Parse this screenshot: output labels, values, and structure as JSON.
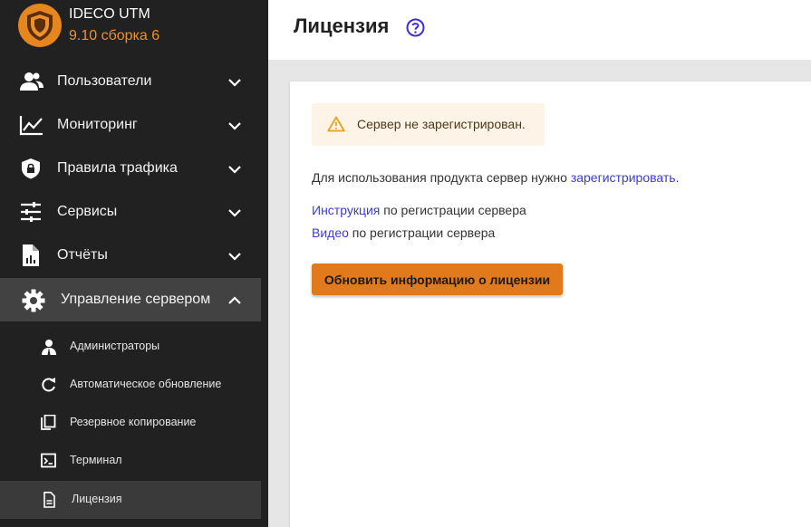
{
  "brand": {
    "name": "IDECO UTM",
    "version": "9.10 сборка 6"
  },
  "sidebar": {
    "items": [
      {
        "label": "Пользователи",
        "icon": "users-icon"
      },
      {
        "label": "Мониторинг",
        "icon": "chart-line-icon"
      },
      {
        "label": "Правила трафика",
        "icon": "shield-lock-icon"
      },
      {
        "label": "Сервисы",
        "icon": "sliders-icon"
      },
      {
        "label": "Отчёты",
        "icon": "report-file-icon"
      },
      {
        "label": "Управление сервером",
        "icon": "gear-icon",
        "expanded": true
      }
    ],
    "subitems": [
      {
        "label": "Администраторы",
        "icon": "admin-user-icon"
      },
      {
        "label": "Автоматическое обновление",
        "icon": "refresh-icon"
      },
      {
        "label": "Резервное копирование",
        "icon": "copy-icon"
      },
      {
        "label": "Терминал",
        "icon": "terminal-icon"
      },
      {
        "label": "Лицензия",
        "icon": "document-icon",
        "active": true
      }
    ]
  },
  "header": {
    "title": "Лицензия"
  },
  "content": {
    "alert": "Сервер не зарегистрирован.",
    "register_prefix": "Для использования продукта сервер нужно ",
    "register_link": "зарегистрировать",
    "register_suffix": ".",
    "instruction_link": "Инструкция",
    "instruction_suffix": " по регистрации сервера",
    "video_link": "Видео",
    "video_suffix": " по регистрации сервера",
    "refresh_button": "Обновить информацию о лицензии"
  },
  "colors": {
    "accent": "#e07a1c",
    "link": "#3b3bd4",
    "sidebar_bg": "#212121",
    "alert_bg": "#fdf3e6"
  }
}
